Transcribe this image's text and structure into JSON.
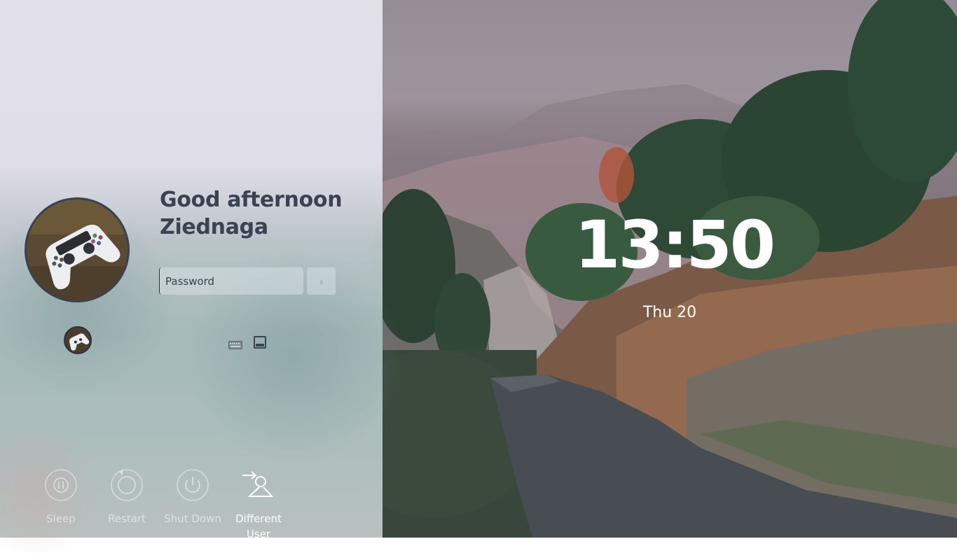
{
  "login": {
    "greeting_line1": "Good afternoon",
    "greeting_line2": "Ziednaga",
    "password_placeholder": "Password",
    "submit_glyph": "›"
  },
  "clock": {
    "time": "13:50",
    "date": "Thu 20"
  },
  "power_actions": [
    {
      "label": "Sleep",
      "icon": "sleep-icon"
    },
    {
      "label": "Restart",
      "icon": "restart-icon"
    },
    {
      "label": "Shut Down",
      "icon": "power-icon"
    },
    {
      "label": "Different\nUser",
      "icon": "switch-user-icon"
    }
  ],
  "icons": {
    "keyboard": "keyboard-icon",
    "virtual_keyboard": "virtual-keyboard-icon",
    "avatar": "gamepad-icon"
  },
  "colors": {
    "greeting_text": "#3b4252",
    "panel_top": "#e2e1ea",
    "panel_bottom": "#b0c2c2"
  }
}
